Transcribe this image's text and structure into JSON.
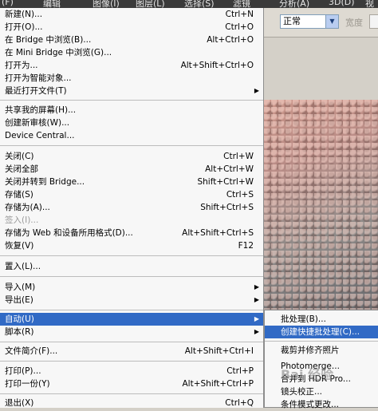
{
  "menubar": {
    "items": [
      "(F)",
      "编辑",
      "图像(I)",
      "图层(L)",
      "选择(S)",
      "滤镜",
      "分析(A)",
      "3D(D)",
      "视"
    ]
  },
  "options_bar": {
    "mode_value": "正常",
    "width_label": "宽度"
  },
  "file_menu": {
    "items": [
      {
        "label": "新建(N)...",
        "shortcut": "Ctrl+N"
      },
      {
        "label": "打开(O)...",
        "shortcut": "Ctrl+O"
      },
      {
        "label": "在 Bridge 中浏览(B)...",
        "shortcut": "Alt+Ctrl+O"
      },
      {
        "label": "在 Mini Bridge 中浏览(G)...",
        "shortcut": ""
      },
      {
        "label": "打开为...",
        "shortcut": "Alt+Shift+Ctrl+O"
      },
      {
        "label": "打开为智能对象...",
        "shortcut": ""
      },
      {
        "label": "最近打开文件(T)",
        "shortcut": ""
      },
      {
        "label": "共享我的屏幕(H)...",
        "shortcut": ""
      },
      {
        "label": "创建新审核(W)...",
        "shortcut": ""
      },
      {
        "label": "Device Central...",
        "shortcut": ""
      },
      {
        "label": "关闭(C)",
        "shortcut": "Ctrl+W"
      },
      {
        "label": "关闭全部",
        "shortcut": "Alt+Ctrl+W"
      },
      {
        "label": "关闭并转到 Bridge...",
        "shortcut": "Shift+Ctrl+W"
      },
      {
        "label": "存储(S)",
        "shortcut": "Ctrl+S"
      },
      {
        "label": "存储为(A)...",
        "shortcut": "Shift+Ctrl+S"
      },
      {
        "label": "签入(I)...",
        "shortcut": ""
      },
      {
        "label": "存储为 Web 和设备所用格式(D)...",
        "shortcut": "Alt+Shift+Ctrl+S"
      },
      {
        "label": "恢复(V)",
        "shortcut": "F12"
      },
      {
        "label": "置入(L)...",
        "shortcut": ""
      },
      {
        "label": "导入(M)",
        "shortcut": ""
      },
      {
        "label": "导出(E)",
        "shortcut": ""
      },
      {
        "label": "自动(U)",
        "shortcut": ""
      },
      {
        "label": "脚本(R)",
        "shortcut": ""
      },
      {
        "label": "文件简介(F)...",
        "shortcut": "Alt+Shift+Ctrl+I"
      },
      {
        "label": "打印(P)...",
        "shortcut": "Ctrl+P"
      },
      {
        "label": "打印一份(Y)",
        "shortcut": "Alt+Shift+Ctrl+P"
      },
      {
        "label": "退出(X)",
        "shortcut": "Ctrl+Q"
      }
    ]
  },
  "automate_submenu": {
    "items": [
      {
        "label": "批处理(B)..."
      },
      {
        "label": "创建快捷批处理(C)..."
      },
      {
        "label": "裁剪并修齐照片"
      },
      {
        "label": "Photomerge..."
      },
      {
        "label": "合并到 HDR Pro..."
      },
      {
        "label": "镜头校正..."
      },
      {
        "label": "条件模式更改..."
      }
    ]
  },
  "watermark": "Bai 经验"
}
